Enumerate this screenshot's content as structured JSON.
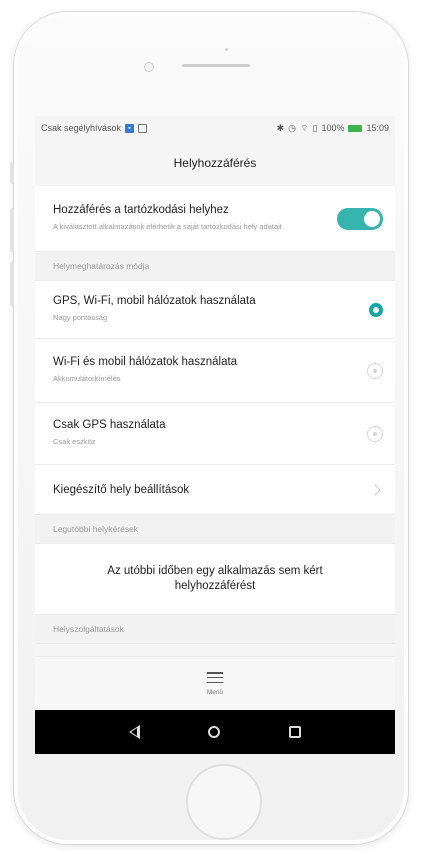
{
  "statusbar": {
    "carrier": "Csak segélyhívások",
    "battery": "100%",
    "time": "15:09"
  },
  "header": {
    "title": "Helyhozzáférés"
  },
  "access": {
    "title": "Hozzáférés a tartózkodási helyhez",
    "subtitle": "A kiválasztott alkalmazások elérhetik a saját tartózkodási hely adatait",
    "enabled": true
  },
  "mode_section": {
    "header": "Helymeghatározás módja"
  },
  "modes": [
    {
      "title": "GPS, Wi-Fi, mobil hálózatok használata",
      "subtitle": "Nagy pontosság",
      "selected": true
    },
    {
      "title": "Wi-Fi és mobil hálózatok használata",
      "subtitle": "Akkumulátorkímélés",
      "selected": false
    },
    {
      "title": "Csak GPS használata",
      "subtitle": "Csak eszköz",
      "selected": false
    }
  ],
  "extra": {
    "title": "Kiegészítő hely beállítások"
  },
  "recent_section": {
    "header": "Legutóbbi helykérések",
    "empty_text": "Az utóbbi időben egy alkalmazás sem kért helyhozzáférést"
  },
  "services_section": {
    "header": "Helyszolgáltatások"
  },
  "menu": {
    "label": "Menü"
  },
  "colors": {
    "accent": "#35b5ae",
    "radio": "#16a6a3"
  }
}
